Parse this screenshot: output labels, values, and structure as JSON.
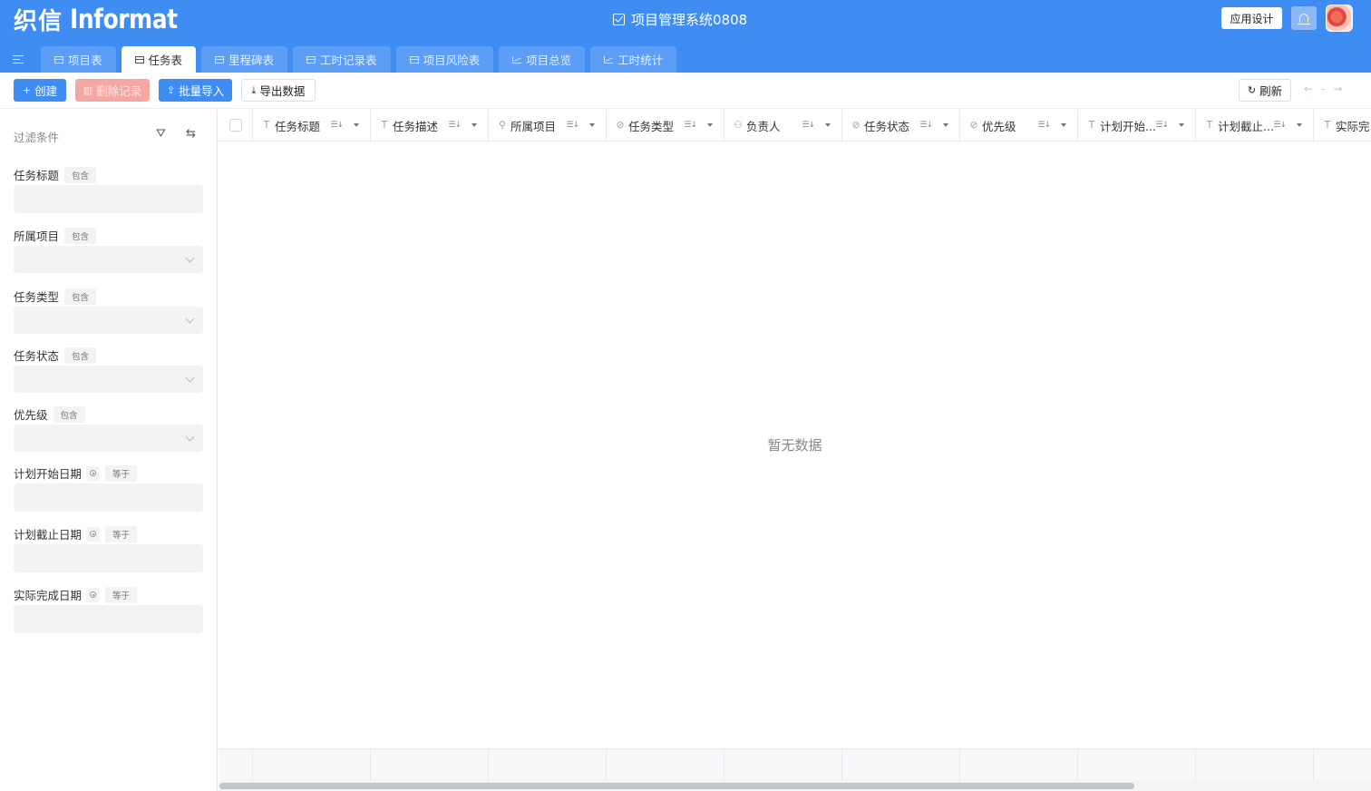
{
  "brand": {
    "mark": "织信",
    "name": "Informat"
  },
  "app": {
    "title": "项目管理系统0808",
    "design_label": "应用设计"
  },
  "tabs": [
    {
      "label": "项目表",
      "icon": "table-icon"
    },
    {
      "label": "任务表",
      "icon": "table-icon",
      "active": true
    },
    {
      "label": "里程碑表",
      "icon": "table-icon"
    },
    {
      "label": "工时记录表",
      "icon": "table-icon"
    },
    {
      "label": "项目风险表",
      "icon": "table-icon"
    },
    {
      "label": "项目总览",
      "icon": "chart-icon"
    },
    {
      "label": "工时统计",
      "icon": "chart-icon"
    }
  ],
  "toolbar": {
    "create": "创建",
    "delete": "删除记录",
    "import": "批量导入",
    "export": "导出数据",
    "refresh": "刷新",
    "page_sep": "-"
  },
  "filters": {
    "heading": "过滤条件",
    "items": [
      {
        "label": "任务标题",
        "op": "包含",
        "kind": "text"
      },
      {
        "label": "所属项目",
        "op": "包含",
        "kind": "select"
      },
      {
        "label": "任务类型",
        "op": "包含",
        "kind": "select"
      },
      {
        "label": "任务状态",
        "op": "包含",
        "kind": "select"
      },
      {
        "label": "优先级",
        "op": "包含",
        "kind": "select"
      },
      {
        "label": "计划开始日期",
        "op": "等于",
        "kind": "date"
      },
      {
        "label": "计划截止日期",
        "op": "等于",
        "kind": "date"
      },
      {
        "label": "实际完成日期",
        "op": "等于",
        "kind": "date"
      }
    ]
  },
  "table": {
    "columns": [
      {
        "label": "任务标题",
        "icon": "T"
      },
      {
        "label": "任务描述",
        "icon": "T"
      },
      {
        "label": "所属项目",
        "icon": "link"
      },
      {
        "label": "任务类型",
        "icon": "check-circle"
      },
      {
        "label": "负责人",
        "icon": "user"
      },
      {
        "label": "任务状态",
        "icon": "check-circle"
      },
      {
        "label": "优先级",
        "icon": "check-circle"
      },
      {
        "label": "计划开始...",
        "icon": "T"
      },
      {
        "label": "计划截止...",
        "icon": "T"
      },
      {
        "label": "实际完...",
        "icon": "T"
      }
    ],
    "empty_text": "暂无数据"
  },
  "colors": {
    "header_bg": "#3f8cf3",
    "tab_bg": "#5c9df6",
    "danger_btn": "#f3a8a4"
  }
}
